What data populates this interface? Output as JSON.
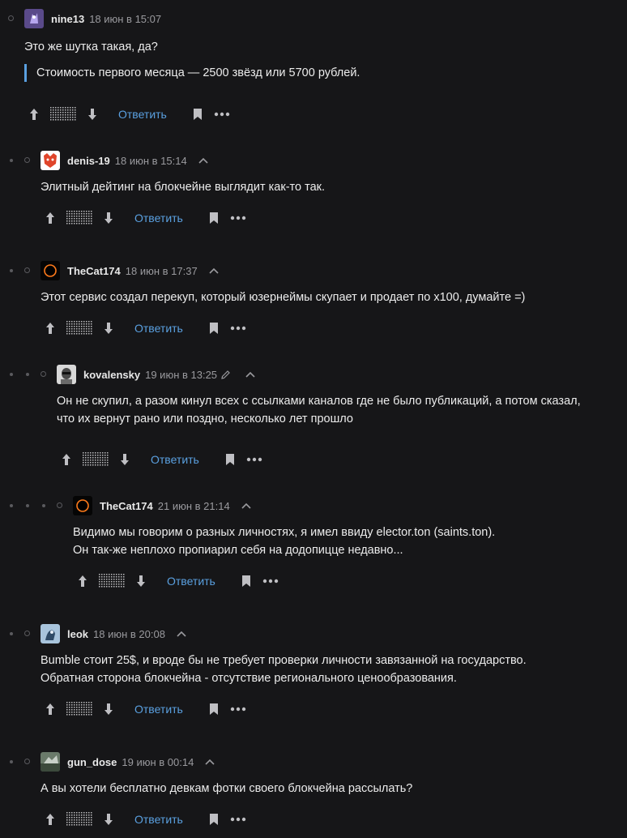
{
  "comments": [
    {
      "user": "nine13",
      "date": "18 июн в 15:07",
      "text_lines": [
        "Это же шутка такая, да?"
      ],
      "quote": "Стоимость первого месяца — 2500 звёзд или 5700 рублей.",
      "reply_label": "Ответить"
    },
    {
      "user": "denis-19",
      "date": "18 июн в 15:14",
      "text_lines": [
        "Элитный дейтинг на блокчейне выглядит как-то так."
      ],
      "reply_label": "Ответить"
    },
    {
      "user": "TheCat174",
      "date": "18 июн в 17:37",
      "text_lines": [
        "Этот сервис создал перекуп, который юзернеймы скупает и продает по x100, думайте =)"
      ],
      "reply_label": "Ответить"
    },
    {
      "user": "kovalensky",
      "date": "19 июн в 13:25",
      "text_lines": [
        "Он не скупил, а разом кинул всех с ссылками каналов где не было публикаций, а потом сказал,",
        "что их вернут рано или поздно, несколько лет прошло"
      ],
      "reply_label": "Ответить"
    },
    {
      "user": "TheCat174",
      "date": "21 июн в 21:14",
      "text_lines": [
        "Видимо мы говорим о разных личностях, я имел ввиду elector.ton (saints.ton).",
        "Он так-же неплохо пропиарил себя на додопицце недавно..."
      ],
      "reply_label": "Ответить"
    },
    {
      "user": "leok",
      "date": "18 июн в 20:08",
      "text_lines": [
        "Bumble стоит 25$, и вроде бы не требует проверки личности завязанной на государство.",
        "Обратная сторона блокчейна - отсутствие регионального ценообразования."
      ],
      "reply_label": "Ответить"
    },
    {
      "user": "gun_dose",
      "date": "19 июн в 00:14",
      "text_lines": [
        "А вы хотели бесплатно девкам фотки своего блокчейна рассылать?"
      ],
      "reply_label": "Ответить"
    }
  ],
  "colors": {
    "background": "#161618",
    "link": "#5aa0e0",
    "quote_bar": "#5aa0e0",
    "muted": "#9a9a9e"
  },
  "icons": [
    "vote-up-icon",
    "vote-down-icon",
    "bookmark-icon",
    "more-icon",
    "parent-comment-icon",
    "edited-pencil-icon"
  ]
}
